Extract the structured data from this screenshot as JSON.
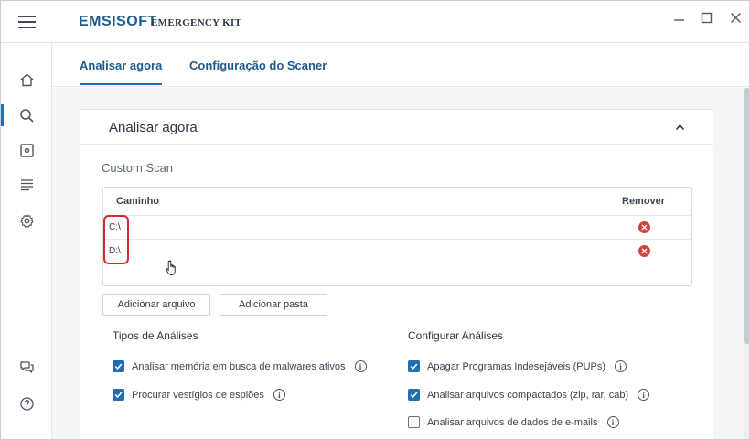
{
  "app": {
    "brand": "EMSISOFT",
    "subtitle": "EMERGENCY KIT"
  },
  "window_controls": {
    "minimize": "—",
    "maximize": "☐",
    "close": "✕"
  },
  "sidebar": {
    "items": [
      {
        "icon": "home-icon"
      },
      {
        "icon": "search-icon",
        "active": true
      },
      {
        "icon": "quarantine-icon"
      },
      {
        "icon": "logs-icon"
      },
      {
        "icon": "settings-icon"
      },
      {
        "icon": "feedback-icon"
      },
      {
        "icon": "help-icon"
      }
    ]
  },
  "tabs": [
    {
      "label": "Analisar agora",
      "active": true
    },
    {
      "label": "Configuração do Scaner",
      "active": false
    }
  ],
  "panel": {
    "title": "Analisar agora",
    "subtitle": "Custom Scan",
    "table": {
      "col_path": "Caminho",
      "col_remove": "Remover",
      "rows": [
        {
          "path": "C:\\"
        },
        {
          "path": "D:\\"
        }
      ]
    },
    "buttons": {
      "add_file": "Adicionar arquivo",
      "add_folder": "Adicionar pasta"
    },
    "scan_types": {
      "title": "Tipos de Análises",
      "options": [
        {
          "label": "Analisar memória em busca de malwares ativos",
          "checked": true
        },
        {
          "label": "Procurar vestígios de espiões",
          "checked": true
        }
      ]
    },
    "scan_config": {
      "title": "Configurar Análises",
      "options": [
        {
          "label": "Apagar Programas Indesejáveis (PUPs)",
          "checked": true
        },
        {
          "label": "Analisar arquivos compactados (zip, rar, cab)",
          "checked": true
        },
        {
          "label": "Analisar arquivos de dados de e-mails",
          "checked": false
        }
      ]
    },
    "info_glyph": "i"
  },
  "colors": {
    "accent": "#1f6fb2",
    "brand": "#1f5b8c",
    "remove": "#d3433b",
    "highlight": "#d62a2a"
  }
}
